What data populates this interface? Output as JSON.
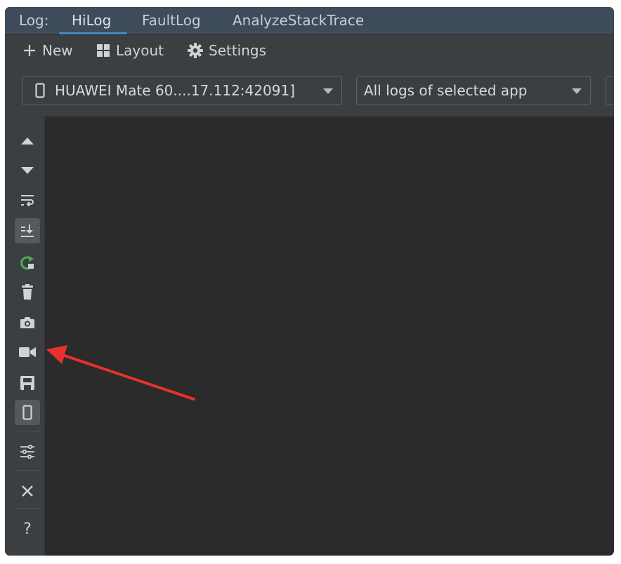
{
  "tabbar": {
    "title": "Log:",
    "tabs": [
      {
        "label": "HiLog",
        "active": true
      },
      {
        "label": "FaultLog",
        "active": false
      },
      {
        "label": "AnalyzeStackTrace",
        "active": false
      }
    ]
  },
  "toolbar": {
    "new_label": "New",
    "layout_label": "Layout",
    "settings_label": "Settings"
  },
  "filters": {
    "device": "HUAWEI Mate 60....17.112:42091]",
    "scope": "All logs of selected app"
  },
  "sidebar": {
    "icons": [
      "scroll-up-icon",
      "scroll-down-icon",
      "soft-wrap-icon",
      "scroll-to-end-icon",
      "restart-icon",
      "clear-log-icon",
      "screenshot-icon",
      "screen-record-icon",
      "save-icon",
      "device-icon",
      "filter-settings-icon",
      "close-icon",
      "help-icon"
    ],
    "help_glyph": "?"
  },
  "colors": {
    "accent": "#4a88c7",
    "annotation": "#e8312c",
    "restart": "#4caf50",
    "log_bg": "#2b2b2b"
  }
}
